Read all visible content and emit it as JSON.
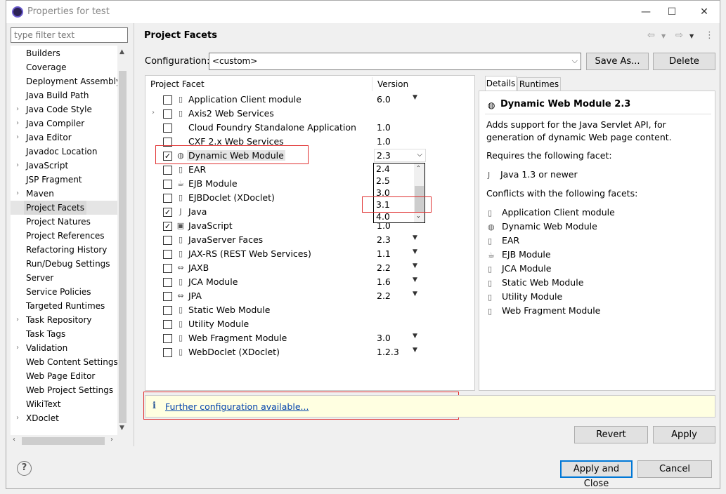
{
  "window": {
    "title": "Properties for test",
    "minimize": "—",
    "maximize": "☐",
    "close": "✕"
  },
  "filter": {
    "placeholder": "type filter text"
  },
  "nav": {
    "items": [
      {
        "label": "Builders",
        "expandable": false
      },
      {
        "label": "Coverage",
        "expandable": false
      },
      {
        "label": "Deployment Assembly",
        "expandable": false
      },
      {
        "label": "Java Build Path",
        "expandable": false
      },
      {
        "label": "Java Code Style",
        "expandable": true
      },
      {
        "label": "Java Compiler",
        "expandable": true
      },
      {
        "label": "Java Editor",
        "expandable": true
      },
      {
        "label": "Javadoc Location",
        "expandable": false
      },
      {
        "label": "JavaScript",
        "expandable": true
      },
      {
        "label": "JSP Fragment",
        "expandable": false
      },
      {
        "label": "Maven",
        "expandable": true
      },
      {
        "label": "Project Facets",
        "expandable": false,
        "selected": true
      },
      {
        "label": "Project Natures",
        "expandable": false
      },
      {
        "label": "Project References",
        "expandable": false
      },
      {
        "label": "Refactoring History",
        "expandable": false
      },
      {
        "label": "Run/Debug Settings",
        "expandable": false
      },
      {
        "label": "Server",
        "expandable": false
      },
      {
        "label": "Service Policies",
        "expandable": false
      },
      {
        "label": "Targeted Runtimes",
        "expandable": false
      },
      {
        "label": "Task Repository",
        "expandable": true
      },
      {
        "label": "Task Tags",
        "expandable": false
      },
      {
        "label": "Validation",
        "expandable": true
      },
      {
        "label": "Web Content Settings",
        "expandable": false
      },
      {
        "label": "Web Page Editor",
        "expandable": false
      },
      {
        "label": "Web Project Settings",
        "expandable": false
      },
      {
        "label": "WikiText",
        "expandable": false
      },
      {
        "label": "XDoclet",
        "expandable": true
      }
    ]
  },
  "page": {
    "title": "Project Facets",
    "configuration_label": "Configuration:",
    "configuration_value": "<custom>",
    "save_as": "Save As...",
    "delete": "Delete"
  },
  "facets": {
    "header_facet": "Project Facet",
    "header_version": "Version",
    "rows": [
      {
        "label": "Application Client module",
        "version": "6.0",
        "checked": false,
        "dropdown": true,
        "icon": "page-icon"
      },
      {
        "label": "Axis2 Web Services",
        "version": "",
        "checked": false,
        "dropdown": false,
        "expandable": true,
        "icon": "page-icon"
      },
      {
        "label": "Cloud Foundry Standalone Application",
        "version": "1.0",
        "checked": false,
        "dropdown": false,
        "icon": "none"
      },
      {
        "label": "CXF 2.x Web Services",
        "version": "1.0",
        "checked": false,
        "dropdown": false,
        "icon": "none"
      },
      {
        "label": "Dynamic Web Module",
        "version": "2.3",
        "checked": true,
        "dropdown": true,
        "icon": "globe-icon",
        "selected": true
      },
      {
        "label": "EAR",
        "version": "",
        "checked": false,
        "dropdown": false,
        "icon": "page-icon"
      },
      {
        "label": "EJB Module",
        "version": "",
        "checked": false,
        "dropdown": false,
        "icon": "bean-icon"
      },
      {
        "label": "EJBDoclet (XDoclet)",
        "version": "",
        "checked": false,
        "dropdown": false,
        "icon": "page-icon"
      },
      {
        "label": "Java",
        "version": "",
        "checked": true,
        "dropdown": false,
        "icon": "java-icon"
      },
      {
        "label": "JavaScript",
        "version": "1.0",
        "checked": true,
        "dropdown": false,
        "icon": "lock-icon"
      },
      {
        "label": "JavaServer Faces",
        "version": "2.3",
        "checked": false,
        "dropdown": true,
        "icon": "page-icon"
      },
      {
        "label": "JAX-RS (REST Web Services)",
        "version": "1.1",
        "checked": false,
        "dropdown": true,
        "icon": "page-icon"
      },
      {
        "label": "JAXB",
        "version": "2.2",
        "checked": false,
        "dropdown": true,
        "icon": "arrows-icon"
      },
      {
        "label": "JCA Module",
        "version": "1.6",
        "checked": false,
        "dropdown": true,
        "icon": "page-icon"
      },
      {
        "label": "JPA",
        "version": "2.2",
        "checked": false,
        "dropdown": true,
        "icon": "arrows-icon"
      },
      {
        "label": "Static Web Module",
        "version": "",
        "checked": false,
        "dropdown": false,
        "icon": "page-icon"
      },
      {
        "label": "Utility Module",
        "version": "",
        "checked": false,
        "dropdown": false,
        "icon": "page-icon"
      },
      {
        "label": "Web Fragment Module",
        "version": "3.0",
        "checked": false,
        "dropdown": true,
        "icon": "page-icon"
      },
      {
        "label": "WebDoclet (XDoclet)",
        "version": "1.2.3",
        "checked": false,
        "dropdown": true,
        "icon": "page-icon"
      }
    ],
    "version_options": [
      "2.4",
      "2.5",
      "3.0",
      "3.1",
      "4.0"
    ]
  },
  "details": {
    "tab_details": "Details",
    "tab_runtimes": "Runtimes",
    "title": "Dynamic Web Module 2.3",
    "description": "Adds support for the Java Servlet API, for generation of dynamic Web page content.",
    "requires_label": "Requires the following facet:",
    "requires": [
      "Java 1.3 or newer"
    ],
    "conflicts_label": "Conflicts with the following facets:",
    "conflicts": [
      "Application Client module",
      "Dynamic Web Module",
      "EAR",
      "EJB Module",
      "JCA Module",
      "Static Web Module",
      "Utility Module",
      "Web Fragment Module"
    ]
  },
  "info": {
    "link": "Further configuration available..."
  },
  "buttons": {
    "revert": "Revert",
    "apply": "Apply",
    "apply_close": "Apply and Close",
    "cancel": "Cancel",
    "help": "?"
  }
}
